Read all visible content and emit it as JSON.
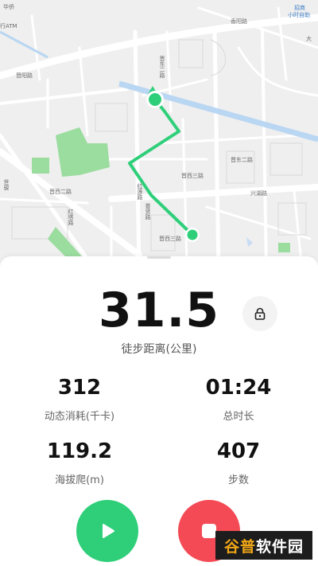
{
  "map": {
    "labels": {
      "huaqiao": "华侨",
      "atm": "行ATM",
      "xiaoshi": "小时自助",
      "zhaoshang": "招商",
      "shishang": "世骏",
      "da": "大",
      "jingjin": "晋阳路",
      "xiangyang": "香阳路",
      "road1": "晋西二路",
      "road2": "晋东二路",
      "road3": "晋西三路",
      "road4": "红莲路",
      "road5": "普贤路",
      "road6": "红塔路",
      "road7": "晋东二路",
      "road8": "兴湖路",
      "road9": "晋西三路"
    }
  },
  "workout": {
    "distance_value": "31.5",
    "distance_label": "徒步距离(公里)"
  },
  "stats": {
    "calories_value": "312",
    "calories_label": "动态消耗(千卡)",
    "duration_value": "01:24",
    "duration_label": "总时长",
    "climb_value": "119.2",
    "climb_label": "海拔爬(m)",
    "steps_value": "407",
    "steps_label": "步数"
  },
  "watermark": {
    "part1": "谷普",
    "part2": "软件园"
  },
  "colors": {
    "route": "#2fcf7a",
    "start": "#2fcf7a",
    "stop": "#f34a55",
    "water": "#b9d6f2",
    "park": "#9bdc9f"
  },
  "icons": {
    "lock": "lock-icon",
    "play": "play-icon",
    "stop": "stop-icon"
  }
}
